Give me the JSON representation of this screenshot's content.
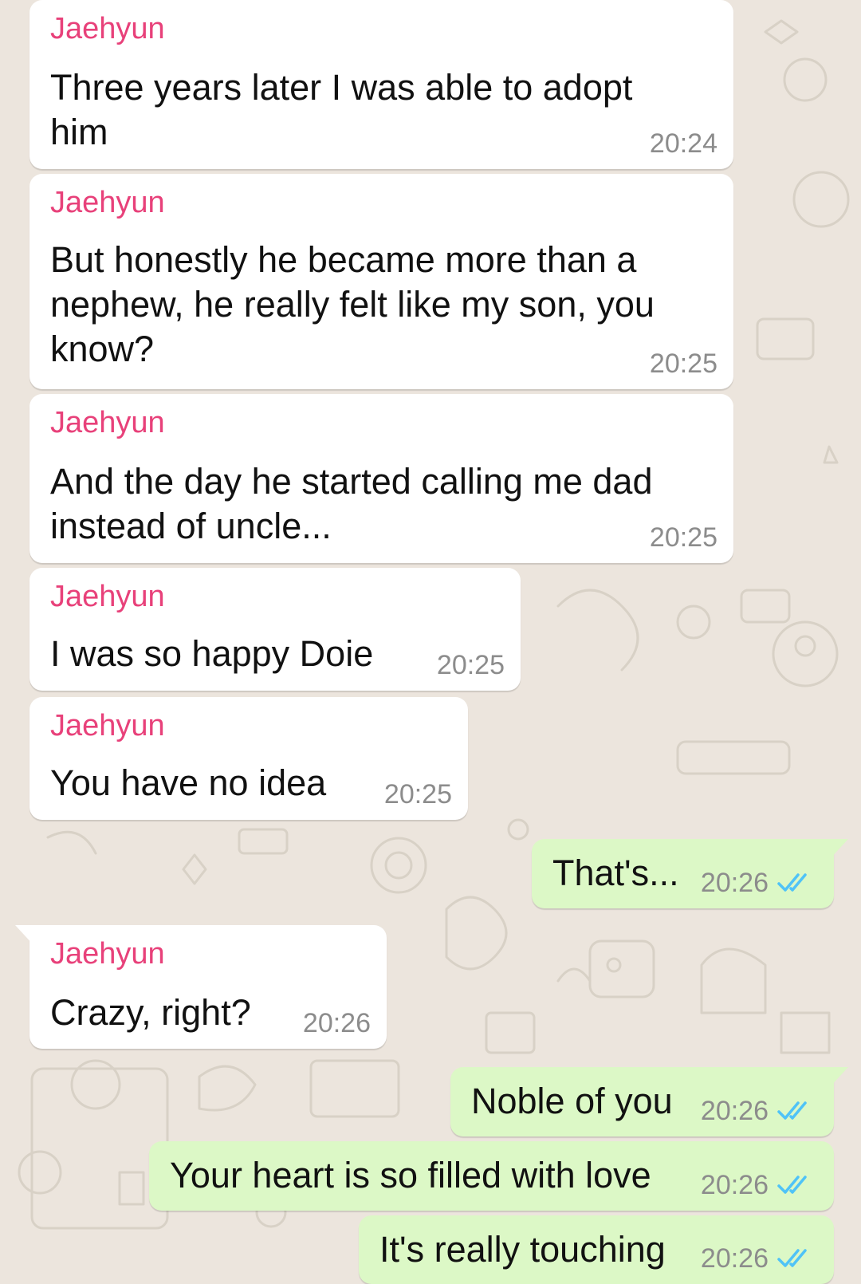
{
  "chat": {
    "colors": {
      "background": "#ECE5DD",
      "incoming_bubble": "#FFFFFF",
      "outgoing_bubble": "#DCF8C6",
      "sender_name": "#E8417A",
      "timestamp": "#8C8C8C",
      "read_ticks": "#4FC3F7"
    },
    "messages": [
      {
        "direction": "incoming",
        "sender": "Jaehyun",
        "text": "Three years later I was able to adopt\nhim",
        "time": "20:24"
      },
      {
        "direction": "incoming",
        "sender": "Jaehyun",
        "text": "But honestly he became more than a\nnephew, he really felt like my son, you\nknow?",
        "time": "20:25"
      },
      {
        "direction": "incoming",
        "sender": "Jaehyun",
        "text": "And the day he started calling me dad\ninstead of uncle...",
        "time": "20:25"
      },
      {
        "direction": "incoming",
        "sender": "Jaehyun",
        "text": "I was so happy Doie",
        "time": "20:25"
      },
      {
        "direction": "incoming",
        "sender": "Jaehyun",
        "text": "You have no idea",
        "time": "20:25"
      },
      {
        "direction": "outgoing",
        "text": "That's...",
        "time": "20:26",
        "status": "read"
      },
      {
        "direction": "incoming",
        "sender": "Jaehyun",
        "text": "Crazy, right?",
        "time": "20:26"
      },
      {
        "direction": "outgoing",
        "text": "Noble of you",
        "time": "20:26",
        "status": "read"
      },
      {
        "direction": "outgoing",
        "text": "Your heart is so filled with love",
        "time": "20:26",
        "status": "read"
      },
      {
        "direction": "outgoing",
        "text": "It's really touching",
        "time": "20:26",
        "status": "read"
      }
    ]
  }
}
